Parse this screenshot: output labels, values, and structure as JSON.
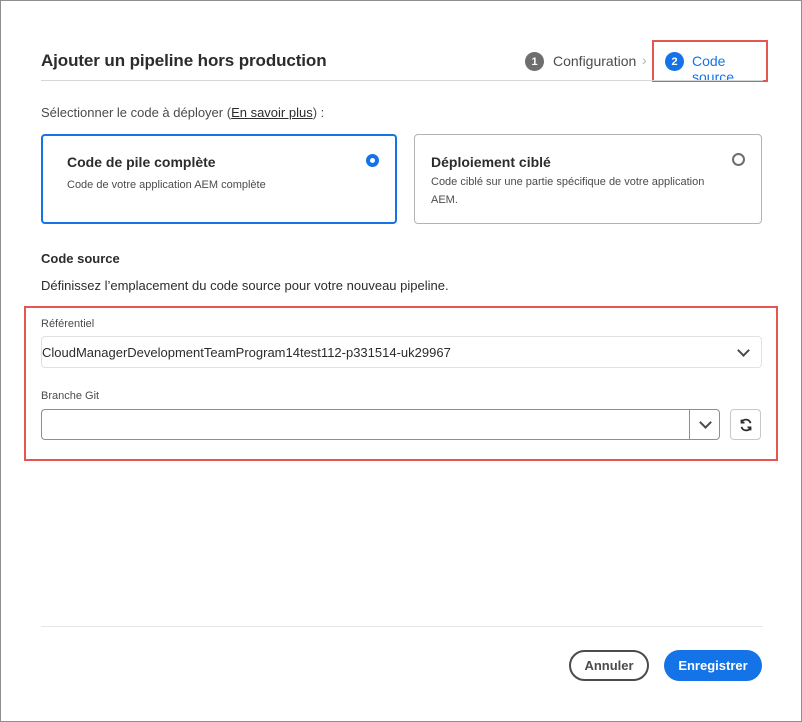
{
  "dialog": {
    "title": "Ajouter un pipeline hors production"
  },
  "steps": [
    {
      "number": "1",
      "label": "Configuration",
      "state": "done",
      "color": "#6e6e6e"
    },
    {
      "number": "2",
      "label": "Code source",
      "state": "active",
      "color": "#1473e6"
    }
  ],
  "intro": {
    "prefix": "Sélectionner le code à déployer (",
    "link": "En savoir plus",
    "suffix": ") :"
  },
  "options": [
    {
      "title": "Code de pile complète",
      "description": "Code de votre application AEM complète",
      "selected": true
    },
    {
      "title": "Déploiement ciblé",
      "description": "Code ciblé sur une partie spécifique de votre application AEM.",
      "selected": false
    }
  ],
  "source": {
    "title": "Code source",
    "description": "Définissez l’emplacement du code source pour votre nouveau pipeline.",
    "repository_label": "Référentiel",
    "repository_value": "CloudManagerDevelopmentTeamProgram14test112-p331514-uk29967",
    "branch_label": "Branche Git",
    "branch_value": ""
  },
  "footer": {
    "cancel_label": "Annuler",
    "save_label": "Enregistrer"
  },
  "colors": {
    "accent": "#1473e6",
    "highlight": "#e4564f"
  },
  "icons": {
    "chevron": "chevron-down-icon",
    "refresh": "refresh-icon",
    "step_separator": "chevron-right-icon"
  }
}
